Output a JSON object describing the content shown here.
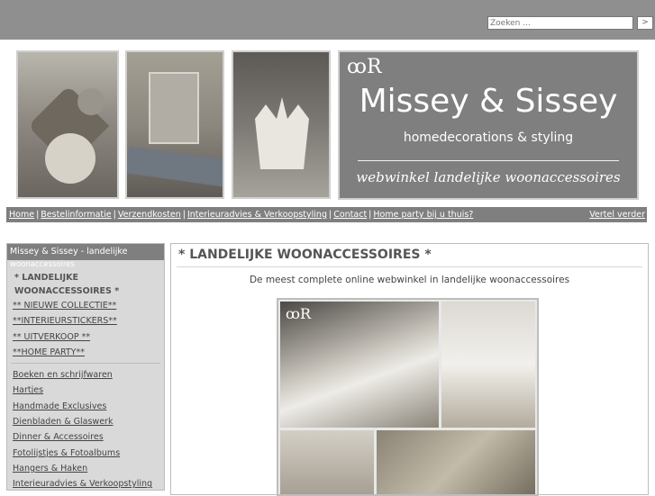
{
  "search": {
    "placeholder": "Zoeken ...",
    "button": ">"
  },
  "logo": {
    "mark": "ꝏR",
    "title": "Missey & Sissey",
    "subtitle": "homedecorations & styling",
    "tagline": "webwinkel landelijke woonaccessoires"
  },
  "nav": {
    "items": [
      {
        "label": "Home"
      },
      {
        "label": "Bestelinformatie"
      },
      {
        "label": "Verzendkosten"
      },
      {
        "label": "Interieuradvies & Verkoopstyling"
      },
      {
        "label": "Contact"
      },
      {
        "label": "Home party bij u thuis?"
      }
    ],
    "right": "Vertel verder",
    "separator": "|"
  },
  "sidebar": {
    "header": "Missey & Sissey - landelijke",
    "header_overflow": "woonaccessoires",
    "active": "* LANDELIJKE WOONACCESSOIRES *",
    "top_links": [
      {
        "label": "** NIEUWE COLLECTIE**"
      },
      {
        "label": "**INTERIEURSTICKERS**"
      },
      {
        "label": "** UITVERKOOP **"
      },
      {
        "label": "**HOME PARTY**"
      }
    ],
    "links": [
      {
        "label": "Boeken en schrijfwaren"
      },
      {
        "label": "Hartjes"
      },
      {
        "label": "Handmade Exclusives"
      },
      {
        "label": "Dienbladen & Glaswerk"
      },
      {
        "label": "Dinner & Accessoires"
      },
      {
        "label": "Fotolijstjes & Fotoalbums"
      },
      {
        "label": "Hangers & Haken"
      },
      {
        "label": "Interieuradvies & Verkoopstyling"
      }
    ]
  },
  "content": {
    "title": "* LANDELIJKE WOONACCESSOIRES *",
    "subtitle": "De meest complete online webwinkel in landelijke woonaccessoires",
    "collage_mark": "ꝏR"
  },
  "colors": {
    "topbar": "#8f8f8f",
    "nav": "#7f7f7f",
    "sidebar": "#d9d9d9"
  }
}
